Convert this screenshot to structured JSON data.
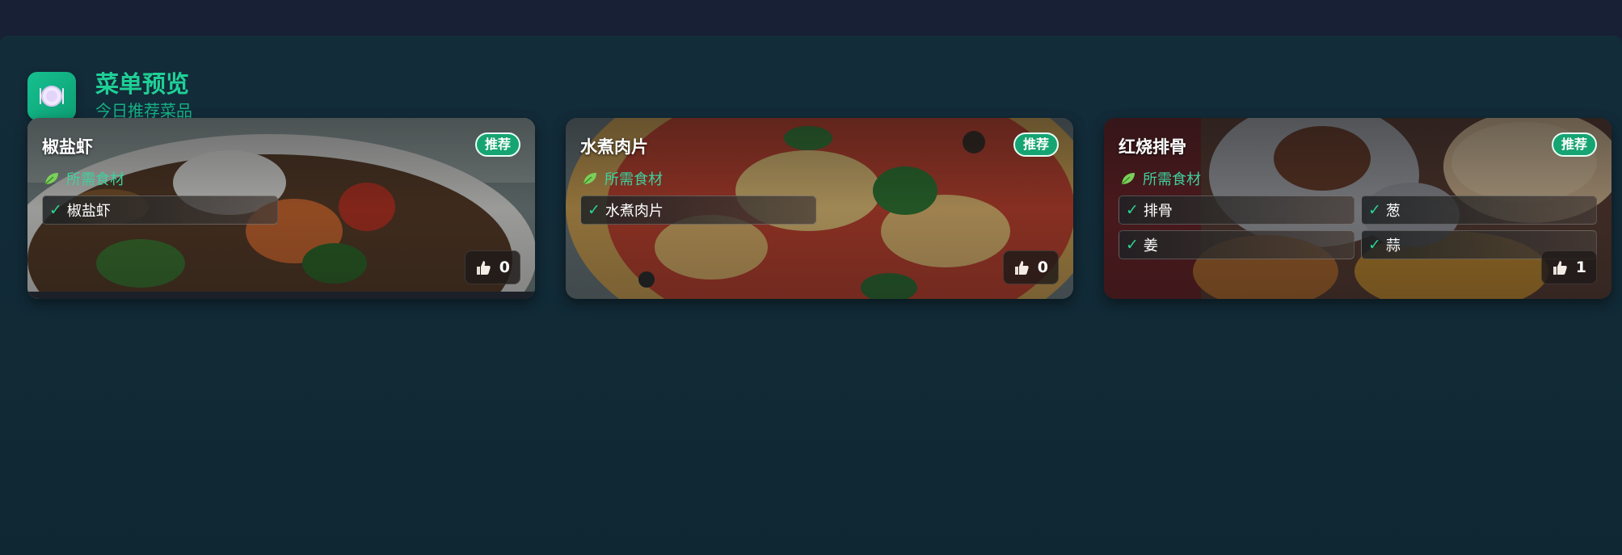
{
  "header": {
    "icon": "plate-icon",
    "title": "菜单预览",
    "subtitle": "今日推荐菜品"
  },
  "cards": [
    {
      "name": "椒盐虾",
      "badge": "推荐",
      "ingredients_label": "所需食材",
      "ingredients": [
        "椒盐虾"
      ],
      "likes": "0"
    },
    {
      "name": "水煮肉片",
      "badge": "推荐",
      "ingredients_label": "所需食材",
      "ingredients": [
        "水煮肉片"
      ],
      "likes": "0"
    },
    {
      "name": "红烧排骨",
      "badge": "推荐",
      "ingredients_label": "所需食材",
      "ingredients": [
        "排骨",
        "葱",
        "姜",
        "蒜"
      ],
      "likes": "1"
    }
  ],
  "colors": {
    "accent": "#1fcf95",
    "badge": "#16a472",
    "check": "#2ad391",
    "background": "#112a36"
  },
  "icons": {
    "check": "✓",
    "leaf": "leaf-icon",
    "like": "thumbs-up-icon"
  }
}
